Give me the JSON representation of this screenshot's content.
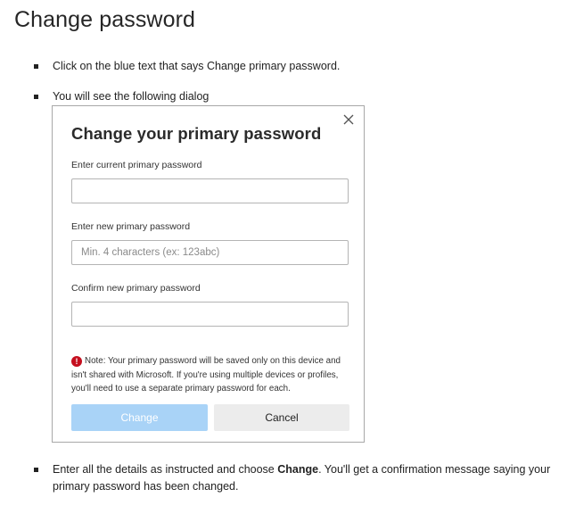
{
  "page": {
    "title": "Change password"
  },
  "steps": {
    "step1": "Click on the blue text that says Change primary password.",
    "step2": "You will see the following dialog",
    "step3_before": "Enter all the details as instructed and choose ",
    "step3_bold": "Change",
    "step3_after": ". You'll get a confirmation message saying your",
    "step3_line2": "primary password has been changed."
  },
  "dialog": {
    "title": "Change your primary password",
    "close_icon": "close-icon",
    "current_label": "Enter current primary password",
    "current_value": "",
    "new_label": "Enter new primary password",
    "new_placeholder": "Min. 4 characters (ex: 123abc)",
    "confirm_label": "Confirm new primary password",
    "confirm_value": "",
    "note_icon": "!",
    "note_text": "Note: Your primary password will be saved only on this device and isn't shared with Microsoft. If you're using multiple devices or profiles, you'll need to use a separate primary password for each.",
    "change_label": "Change",
    "cancel_label": "Cancel"
  },
  "colors": {
    "change_button_bg": "#a9d3f7",
    "cancel_button_bg": "#ececec",
    "note_icon": "#c50f1f"
  }
}
